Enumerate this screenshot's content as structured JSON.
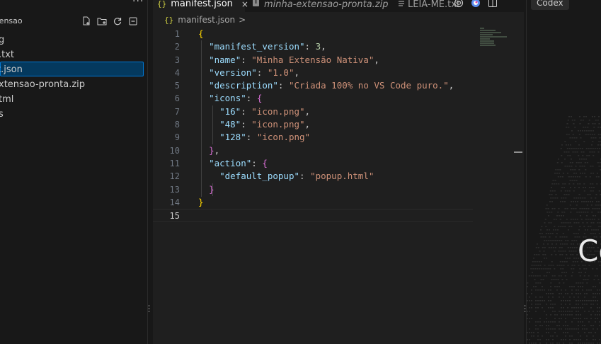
{
  "explorer": {
    "more_label": "···",
    "folder_name": "ktensao",
    "actions": [
      "new-file-icon",
      "new-folder-icon",
      "refresh-icon",
      "collapse-all-icon"
    ],
    "files": [
      {
        "name": "g"
      },
      {
        "name": ".txt"
      },
      {
        "name": "t.json",
        "selected": true
      },
      {
        "name": "xtensao-pronta.zip"
      },
      {
        "name": "tml"
      },
      {
        "name": "s"
      }
    ]
  },
  "tabs": [
    {
      "label": "manifest.json",
      "icon_text": "{}",
      "close": "×",
      "active": true
    },
    {
      "label": "minha-extensao-pronta.zip",
      "active": false
    },
    {
      "label": "LEIA-ME.txt",
      "active": false
    }
  ],
  "breadcrumb": {
    "icon_text": "{}",
    "file": "manifest.json",
    "sep": ">"
  },
  "editor": {
    "current_line": 15,
    "lines": [
      {
        "n": "1"
      },
      {
        "n": "2"
      },
      {
        "n": "3"
      },
      {
        "n": "4"
      },
      {
        "n": "5"
      },
      {
        "n": "6"
      },
      {
        "n": "7"
      },
      {
        "n": "8"
      },
      {
        "n": "9"
      },
      {
        "n": "10"
      },
      {
        "n": "11"
      },
      {
        "n": "12"
      },
      {
        "n": "13"
      },
      {
        "n": "14"
      },
      {
        "n": "15"
      }
    ],
    "code": {
      "l1_open": "{",
      "l2_key": "\"manifest_version\"",
      "l2_val": "3",
      "l3_key": "\"name\"",
      "l3_val": "\"Minha Extensão Nativa\"",
      "l4_key": "\"version\"",
      "l4_val": "\"1.0\"",
      "l5_key": "\"description\"",
      "l5_val": "\"Criada 100% no VS Code puro.\"",
      "l6_key": "\"icons\"",
      "l6_open": "{",
      "l7_key": "\"16\"",
      "l7_val": "\"icon.png\"",
      "l8_key": "\"48\"",
      "l8_val": "\"icon.png\"",
      "l9_key": "\"128\"",
      "l9_val": "\"icon.png\"",
      "l10_close": "}",
      "l11_key": "\"action\"",
      "l11_open": "{",
      "l12_key": "\"default_popup\"",
      "l12_val": "\"popup.html\"",
      "l13_close": "}",
      "l14_close": "}"
    }
  },
  "right_panel": {
    "tab_label": "Codex",
    "big_text": "Co"
  },
  "colors": {
    "accent": "#0078d4",
    "selection": "#04395e",
    "json_key": "#9cdcfe",
    "json_string": "#ce9178",
    "json_number": "#b5cea8"
  }
}
